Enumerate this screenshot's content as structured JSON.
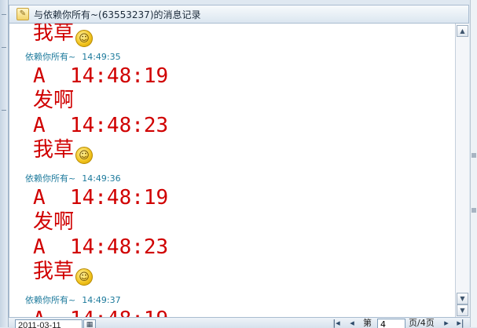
{
  "header": {
    "title": "与依赖你所有~(63553237)的消息记录"
  },
  "messages": [
    {
      "sender": "",
      "time": "",
      "lines": [
        "我草"
      ],
      "emoji": true
    },
    {
      "sender": "依赖你所有~",
      "time": "14:49:35",
      "lines": [
        "A  14:48:19",
        "发啊",
        "A  14:48:23",
        "我草"
      ],
      "emoji": true
    },
    {
      "sender": "依赖你所有~",
      "time": "14:49:36",
      "lines": [
        "A  14:48:19",
        "发啊",
        "A  14:48:23",
        "我草"
      ],
      "emoji": true
    },
    {
      "sender": "依赖你所有~",
      "time": "14:49:37",
      "lines": [
        "A  14:48:19"
      ],
      "emoji": false
    }
  ],
  "footer": {
    "date": "2011-03-11",
    "page_prefix": "第",
    "page_value": "4",
    "page_suffix": "页/4页"
  },
  "icons": {
    "header": "chat-history-icon",
    "emoji": "shy-smiley-icon",
    "calendar": "calendar-icon"
  }
}
